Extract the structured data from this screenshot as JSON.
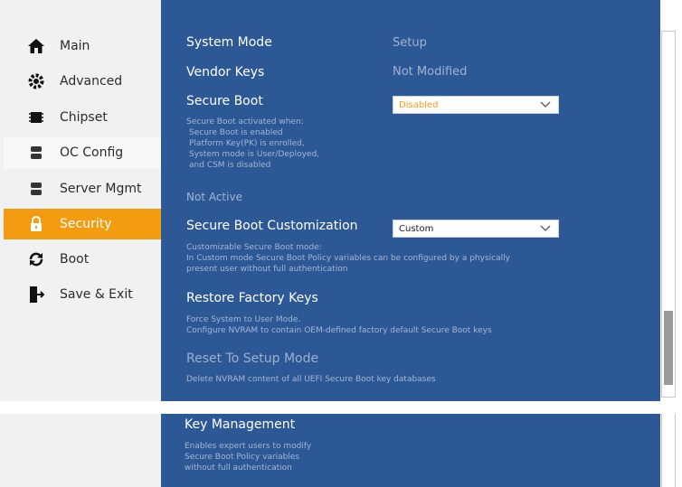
{
  "sidebar": {
    "items": [
      {
        "label": "Main",
        "icon": "home-icon"
      },
      {
        "label": "Advanced",
        "icon": "gear-icon"
      },
      {
        "label": "Chipset",
        "icon": "chip-icon"
      },
      {
        "label": "OC Config",
        "icon": "server-icon"
      },
      {
        "label": "Server Mgmt",
        "icon": "server-icon"
      },
      {
        "label": "Security",
        "icon": "lock-icon"
      },
      {
        "label": "Boot",
        "icon": "refresh-icon"
      },
      {
        "label": "Save & Exit",
        "icon": "exit-icon"
      }
    ],
    "active": "Security"
  },
  "settings": {
    "system_mode": {
      "label": "System Mode",
      "value": "Setup"
    },
    "vendor_keys": {
      "label": "Vendor Keys",
      "value": "Not Modified"
    },
    "secure_boot": {
      "label": "Secure Boot",
      "selected": "Disabled",
      "help": [
        "Secure Boot activated when:",
        "Secure Boot is enabled",
        "Platform Key(PK) is enrolled,",
        "System mode is User/Deployed,",
        "and CSM is disabled"
      ]
    },
    "status": "Not Active",
    "customization": {
      "label": "Secure Boot Customization",
      "selected": "Custom",
      "help": [
        "Customizable Secure Boot mode:",
        "In Custom mode Secure Boot Policy variables can be configured by a physically",
        "present user without full authentication"
      ]
    },
    "restore": {
      "label": "Restore Factory Keys",
      "help": [
        "Force System to User Mode.",
        "Configure NVRAM to contain OEM-defined factory default Secure Boot keys"
      ]
    },
    "reset": {
      "label": "Reset To Setup Mode",
      "help": [
        "Delete NVRAM content of all UEFI Secure Boot key databases"
      ]
    },
    "key_mgmt": {
      "label": "Key Management",
      "help": [
        "Enables expert users to modify",
        "Secure Boot Policy variables",
        "without full authentication"
      ]
    }
  },
  "colors": {
    "accent": "#f39c12",
    "panel": "#2d5896"
  }
}
